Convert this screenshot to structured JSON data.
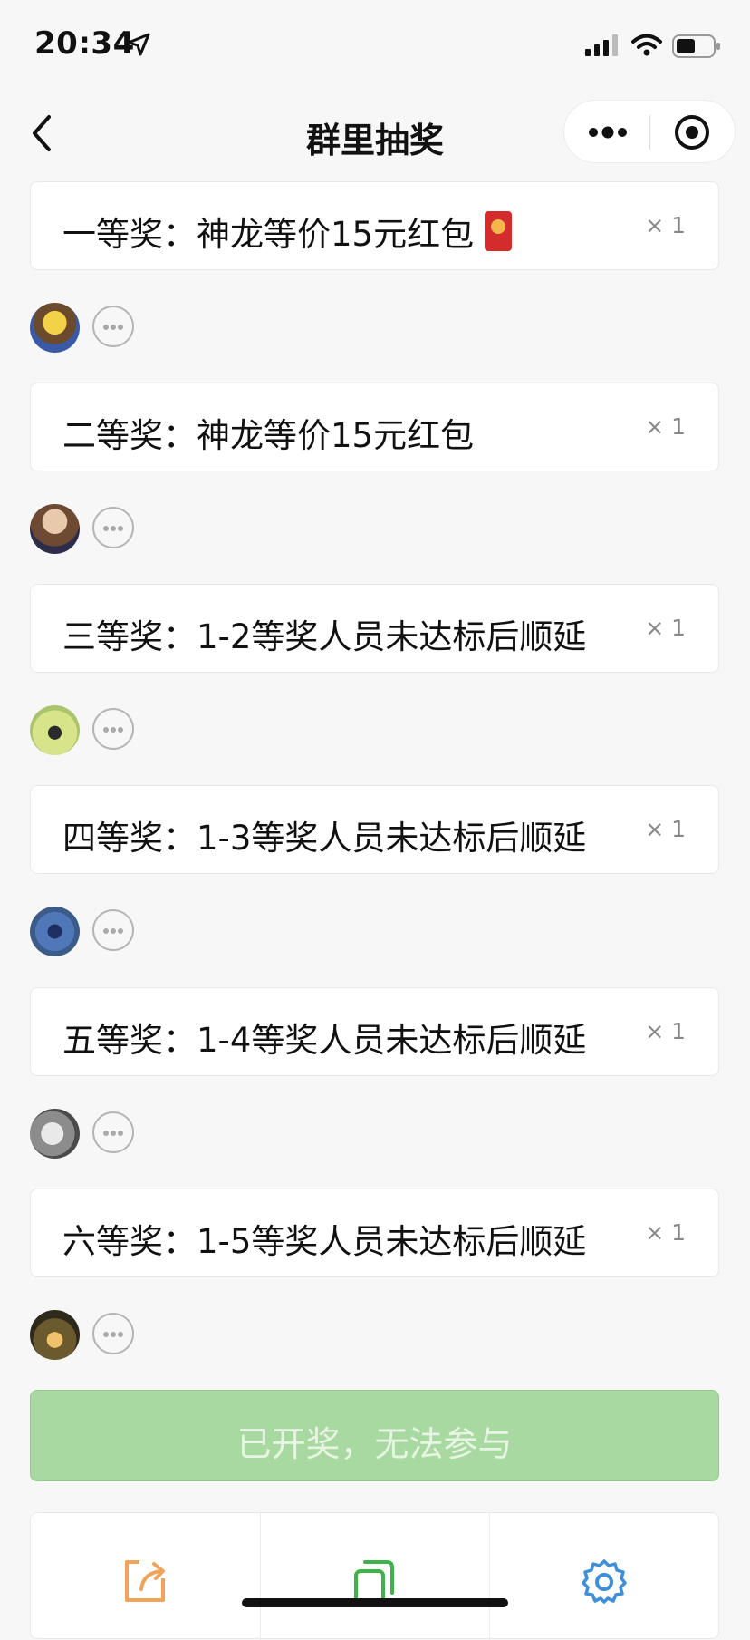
{
  "status_bar": {
    "time": "20:34"
  },
  "nav": {
    "title": "群里抽奖"
  },
  "prizes": [
    {
      "label": "一等奖：神龙等价15元红包",
      "count": "× 1",
      "has_red_packet_icon": true
    },
    {
      "label": "二等奖：神龙等价15元红包",
      "count": "× 1"
    },
    {
      "label": "三等奖：1-2等奖人员未达标后顺延",
      "count": "× 1"
    },
    {
      "label": "四等奖：1-3等奖人员未达标后顺延",
      "count": "× 1"
    },
    {
      "label": "五等奖：1-4等奖人员未达标后顺延",
      "count": "× 1"
    },
    {
      "label": "六等奖：1-5等奖人员未达标后顺延",
      "count": "× 1"
    }
  ],
  "join_button": {
    "label": "已开奖，无法参与",
    "enabled": false
  },
  "toolbar": {
    "icons": [
      "share-icon",
      "copy-icon",
      "settings-icon"
    ],
    "colors": {
      "share": "#f0a35a",
      "copy": "#3fb24a",
      "settings": "#3f8fd8"
    }
  },
  "colors": {
    "accent_green": "#a8d9a0",
    "red_packet": "#d42c2c"
  }
}
